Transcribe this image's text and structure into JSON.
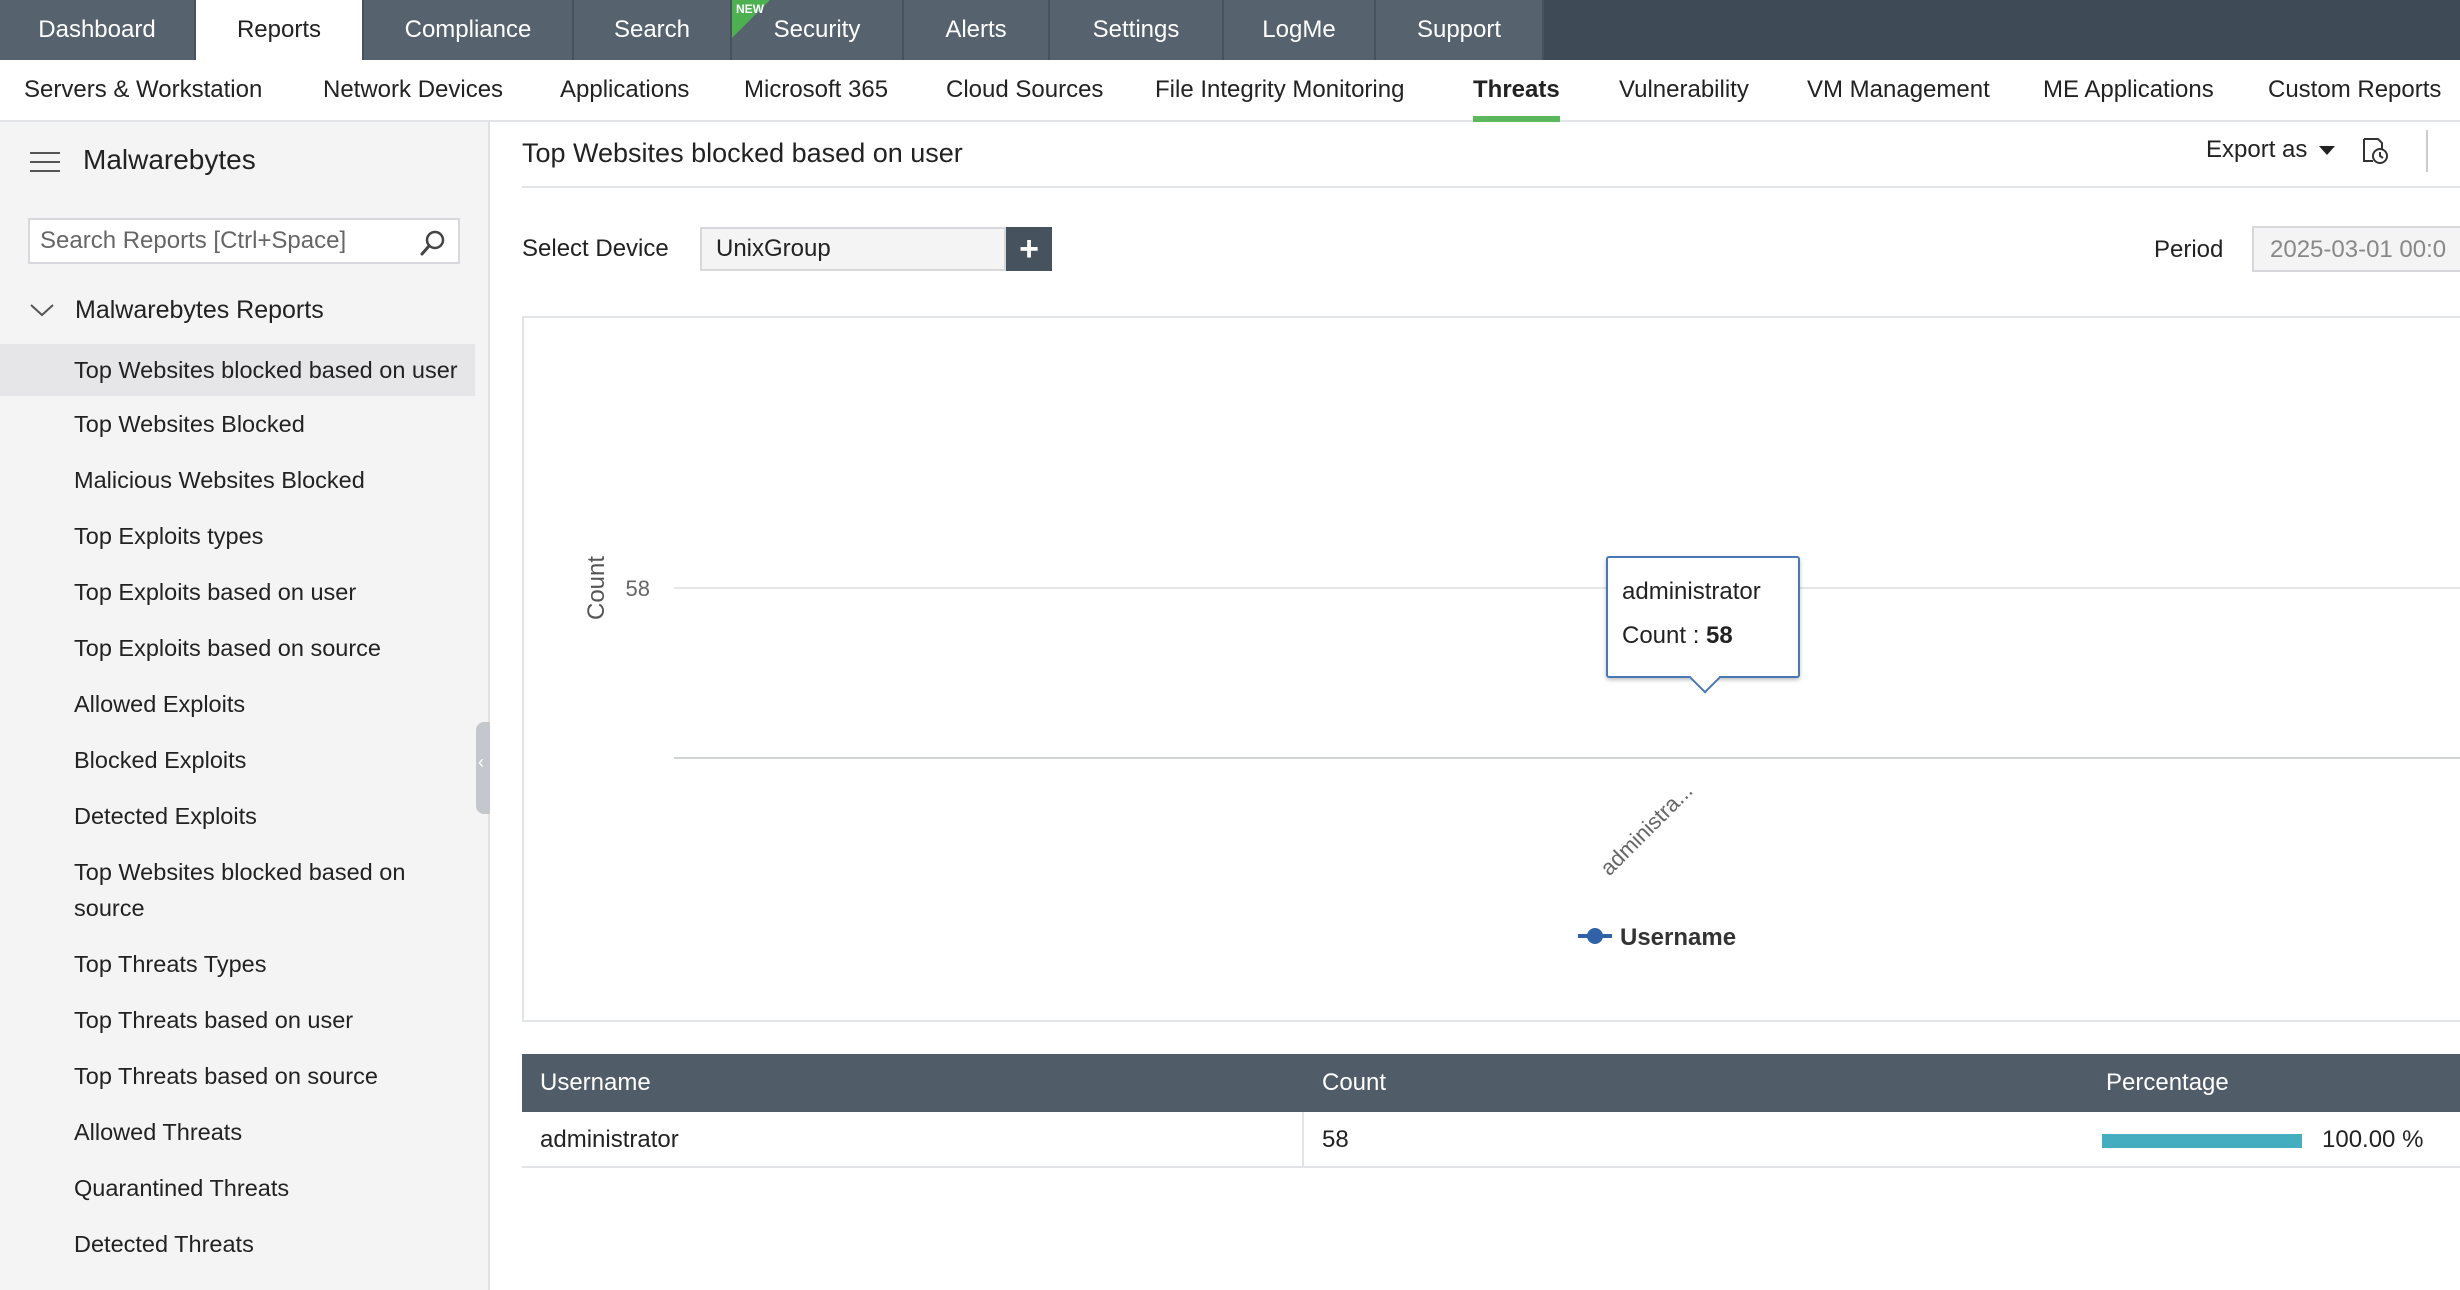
{
  "topnav": {
    "tabs": [
      {
        "label": "Dashboard",
        "active": false
      },
      {
        "label": "Reports",
        "active": true
      },
      {
        "label": "Compliance",
        "active": false
      },
      {
        "label": "Search",
        "active": false
      },
      {
        "label": "Security",
        "active": false,
        "badge": "NEW"
      },
      {
        "label": "Alerts",
        "active": false
      },
      {
        "label": "Settings",
        "active": false
      },
      {
        "label": "LogMe",
        "active": false
      },
      {
        "label": "Support",
        "active": false
      }
    ]
  },
  "subnav": {
    "items": [
      {
        "label": "Servers & Workstation",
        "active": false
      },
      {
        "label": "Network Devices",
        "active": false
      },
      {
        "label": "Applications",
        "active": false
      },
      {
        "label": "Microsoft 365",
        "active": false
      },
      {
        "label": "Cloud Sources",
        "active": false
      },
      {
        "label": "File Integrity Monitoring",
        "active": false
      },
      {
        "label": "Threats",
        "active": true
      },
      {
        "label": "Vulnerability",
        "active": false
      },
      {
        "label": "VM Management",
        "active": false
      },
      {
        "label": "ME Applications",
        "active": false
      },
      {
        "label": "Custom Reports",
        "active": false
      }
    ],
    "active_color": "#5cb85c"
  },
  "sidebar": {
    "title": "Malwarebytes",
    "search_placeholder": "Search Reports [Ctrl+Space]",
    "group_label": "Malwarebytes Reports",
    "items": [
      {
        "label": "Top Websites blocked based on user",
        "active": true
      },
      {
        "label": "Top Websites Blocked",
        "active": false
      },
      {
        "label": "Malicious Websites Blocked",
        "active": false
      },
      {
        "label": "Top Exploits types",
        "active": false
      },
      {
        "label": "Top Exploits based on user",
        "active": false
      },
      {
        "label": "Top Exploits based on source",
        "active": false
      },
      {
        "label": "Allowed Exploits",
        "active": false
      },
      {
        "label": "Blocked Exploits",
        "active": false
      },
      {
        "label": "Detected Exploits",
        "active": false
      },
      {
        "label": "Top Websites blocked based on source",
        "active": false
      },
      {
        "label": "Top Threats Types",
        "active": false
      },
      {
        "label": "Top Threats based on user",
        "active": false
      },
      {
        "label": "Top Threats based on source",
        "active": false
      },
      {
        "label": "Allowed Threats",
        "active": false
      },
      {
        "label": "Quarantined Threats",
        "active": false
      },
      {
        "label": "Detected Threats",
        "active": false
      }
    ]
  },
  "main": {
    "title": "Top Websites blocked based on user",
    "export_label": "Export as",
    "device_label": "Select Device",
    "device_value": "UnixGroup",
    "add_label": "+",
    "period_label": "Period",
    "period_value": "2025-03-01 00:0"
  },
  "tooltip": {
    "name": "administrator",
    "count_label": "Count : ",
    "count_value": "58"
  },
  "chart_data": {
    "type": "line",
    "categories": [
      "administrator"
    ],
    "category_tick_labels": [
      "administra..."
    ],
    "series": [
      {
        "name": "Username",
        "values": [
          58
        ],
        "color": "#2f62a8"
      }
    ],
    "ylabel": "Count",
    "xlabel": "",
    "y_ticks": [
      58
    ],
    "grid": true,
    "legend": "bottom-center"
  },
  "table": {
    "headers": [
      "Username",
      "Count",
      "Percentage"
    ],
    "rows": [
      {
        "username": "administrator",
        "count": "58",
        "percentage_text": "100.00 %",
        "percentage": 100
      }
    ],
    "bar_color": "#45adc0",
    "header_color": "#505d69"
  }
}
